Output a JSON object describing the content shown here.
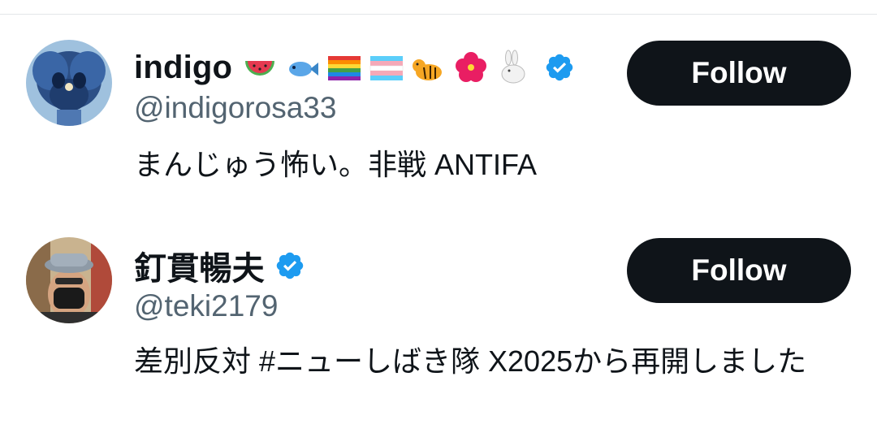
{
  "users": [
    {
      "display_name": "indigo",
      "handle": "@indigorosa33",
      "bio": "まんじゅう怖い。非戦 ANTIFA",
      "verified": true,
      "follow_label": "Follow",
      "name_emojis": [
        "watermelon-emoji",
        "fish-emoji",
        "rainbow-flag-emoji",
        "transgender-flag-emoji",
        "tiger-emoji",
        "hibiscus-emoji",
        "rabbit-emoji"
      ]
    },
    {
      "display_name": "釘貫暢夫",
      "handle": "@teki2179",
      "bio": "差別反対 #ニューしばき隊 X2025から再開しました",
      "verified": true,
      "follow_label": "Follow",
      "name_emojis": []
    }
  ],
  "colors": {
    "verified_blue": "#1d9bf0",
    "follow_button_bg": "#0f1419",
    "handle_gray": "#536471"
  }
}
